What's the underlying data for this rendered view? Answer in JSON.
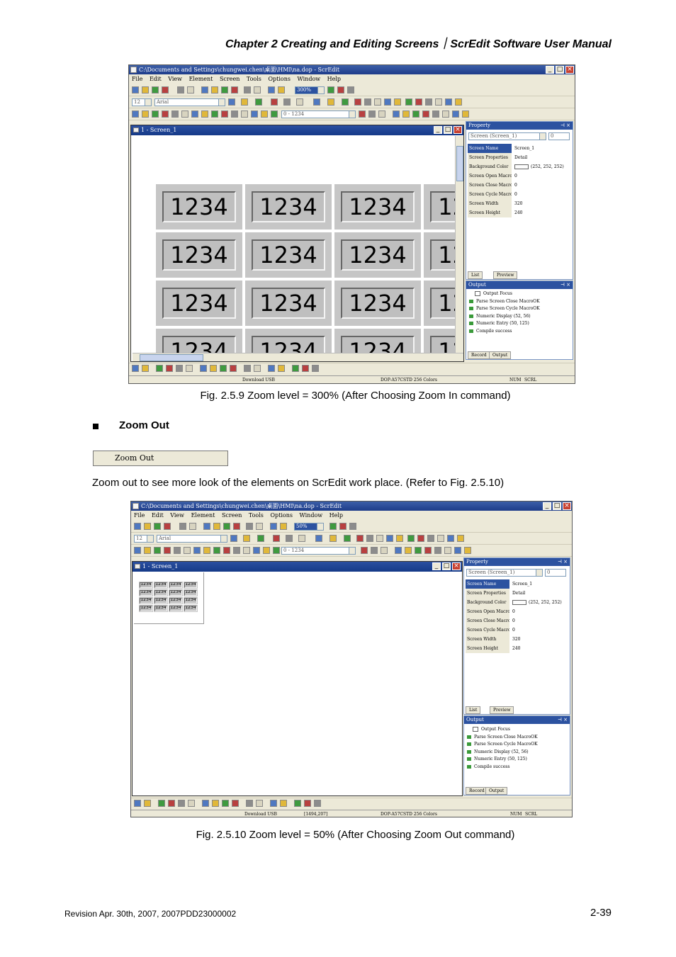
{
  "header": "Chapter 2  Creating and Editing Screens｜ScrEdit Software User Manual",
  "app": {
    "title": "C:\\Documents and Settings\\chungwei.chen\\桌面\\HMI\\na.dop - ScrEdit",
    "menu": [
      "File",
      "Edit",
      "View",
      "Element",
      "Screen",
      "Tools",
      "Options",
      "Window",
      "Help"
    ],
    "font_size": "12",
    "font_name": "Arial",
    "range_text": "0 - 1234",
    "screen_window_title": "1 - Screen_1",
    "property_title": "Property",
    "screen_selector": "Screen (Screen_1)",
    "screen_selector_num": "0",
    "properties": [
      {
        "key": "Screen Name",
        "value": "Screen_1"
      },
      {
        "key": "Screen Properties",
        "value": "Detail"
      },
      {
        "key": "Background Color",
        "value": "(252, 252, 252)"
      },
      {
        "key": "Screen Open Macro",
        "value": "0"
      },
      {
        "key": "Screen Close Macro",
        "value": "0"
      },
      {
        "key": "Screen Cycle Macro",
        "value": "0"
      },
      {
        "key": "Screen Width",
        "value": "320"
      },
      {
        "key": "Screen Height",
        "value": "240"
      }
    ],
    "tab_list": "List",
    "tab_preview": "Preview",
    "output_title": "Output",
    "output_lines": [
      "Output Focus",
      "Parse Screen Close MacroOK",
      "Parse Screen Cycle MacroOK",
      "Numeric Display (52, 56)",
      "Numeric Entry (50, 125)",
      "Compile success"
    ],
    "tab_record": "Record",
    "tab_output": "Output",
    "cell_text": "1234",
    "status_download": "Download USB",
    "status_model": "DOP-A57CSTD 256 Colors",
    "status_num": "NUM",
    "status_scrl": "SCRL"
  },
  "fig1": {
    "zoom": "300%",
    "caption": "Fig. 2.5.9 Zoom level = 300% (After Choosing Zoom In command)",
    "coords": ""
  },
  "section_title": "Zoom Out",
  "zoom_out_label": "Zoom Out",
  "paragraph": "Zoom out to see more look of the elements on ScrEdit work place. (Refer to Fig. 2.5.10)",
  "fig2": {
    "zoom": "50%",
    "caption": "Fig. 2.5.10 Zoom level = 50% (After Choosing Zoom Out command)",
    "coords": "[1494,207]"
  },
  "footer_left": "Revision Apr. 30th, 2007, 2007PDD23000002",
  "footer_right": "2-39"
}
